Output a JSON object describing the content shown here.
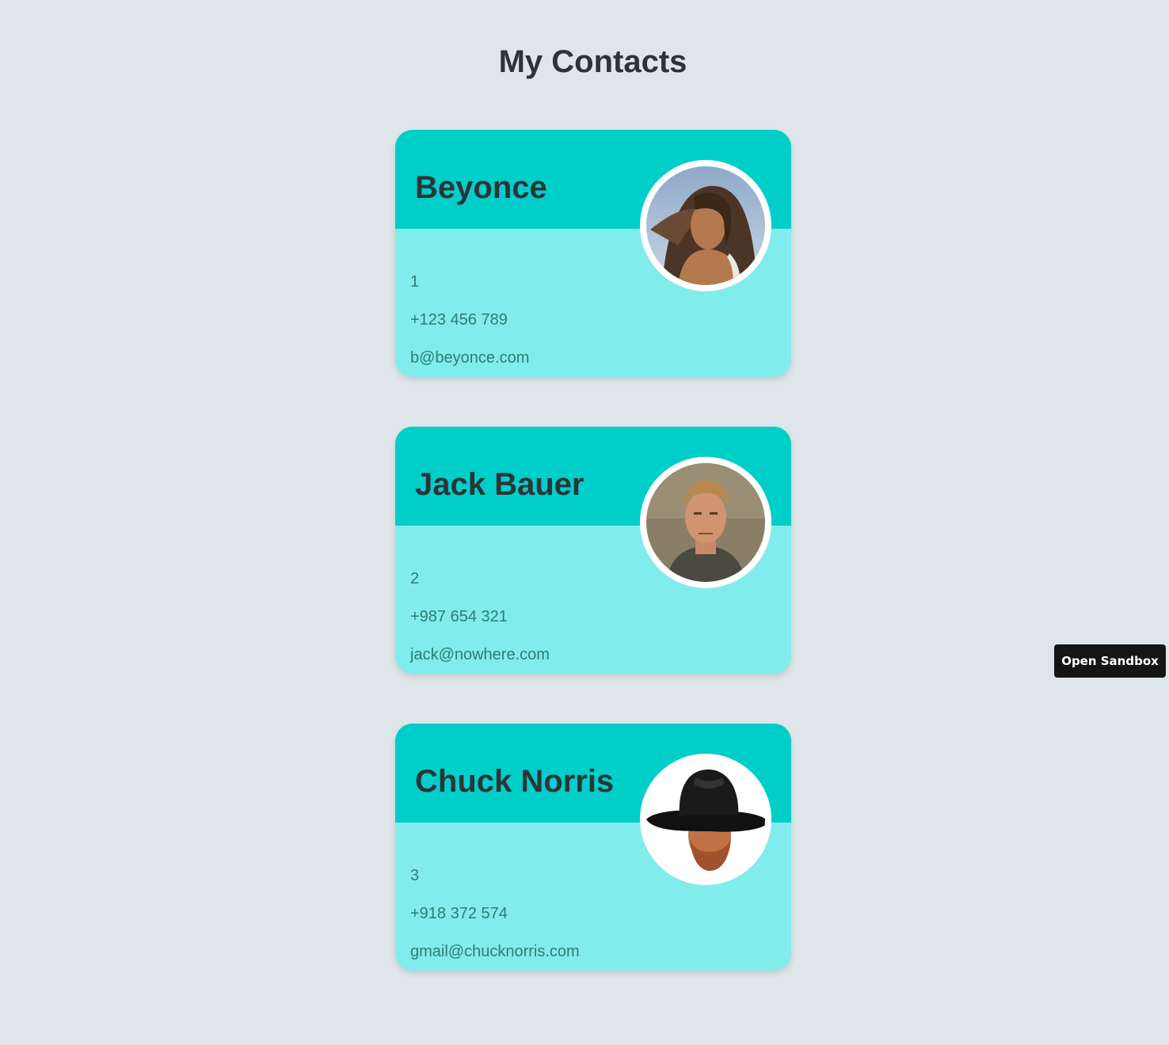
{
  "page": {
    "title": "My Contacts"
  },
  "contacts": [
    {
      "name": "Beyonce",
      "id": "1",
      "phone": "+123 456 789",
      "email": "b@beyonce.com",
      "avatar": "beyonce-photo"
    },
    {
      "name": "Jack Bauer",
      "id": "2",
      "phone": "+987 654 321",
      "email": "jack@nowhere.com",
      "avatar": "jack-bauer-photo"
    },
    {
      "name": "Chuck Norris",
      "id": "3",
      "phone": "+918 372 574",
      "email": "gmail@chucknorris.com",
      "avatar": "chuck-norris-photo"
    }
  ],
  "sandbox": {
    "button_label": "Open Sandbox"
  },
  "colors": {
    "background": "#dfe6e9",
    "card_top": "#00cec9",
    "card_bottom": "#81ecec",
    "title_text": "#2d3436",
    "info_text": "#2e7d73",
    "sandbox_button": "#151515"
  }
}
